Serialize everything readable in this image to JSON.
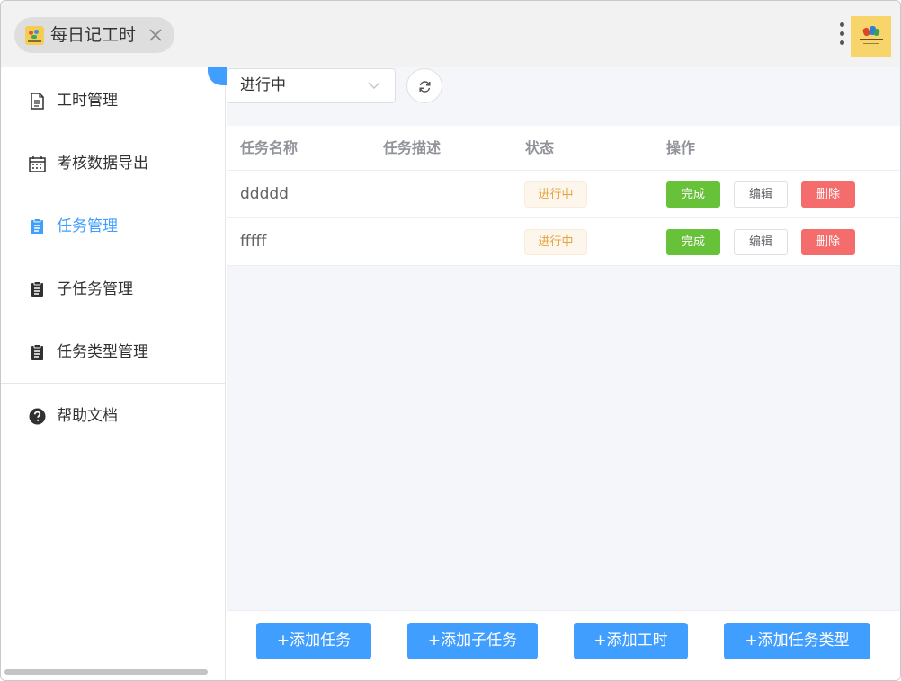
{
  "window": {
    "app_title": "每日记工时"
  },
  "sidebar": {
    "items": [
      {
        "label": "工时管理"
      },
      {
        "label": "考核数据导出"
      },
      {
        "label": "任务管理"
      },
      {
        "label": "子任务管理"
      },
      {
        "label": "任务类型管理"
      },
      {
        "label": "帮助文档"
      }
    ],
    "active_index": 2
  },
  "filter": {
    "status_selected": "进行中"
  },
  "table": {
    "columns": [
      "任务名称",
      "任务描述",
      "状态",
      "操作"
    ],
    "rows": [
      {
        "name": "ddddd",
        "description": "",
        "status": "进行中"
      },
      {
        "name": "fffff",
        "description": "",
        "status": "进行中"
      }
    ],
    "actions": {
      "done": "完成",
      "edit": "编辑",
      "delete": "删除"
    }
  },
  "footer": {
    "add_task": "+添加任务",
    "add_subtask": "+添加子任务",
    "add_worktime": "+添加工时",
    "add_task_type": "+添加任务类型"
  },
  "colors": {
    "primary": "#409eff",
    "success": "#67c23a",
    "danger": "#f56c6c",
    "warning": "#e6a23c"
  }
}
